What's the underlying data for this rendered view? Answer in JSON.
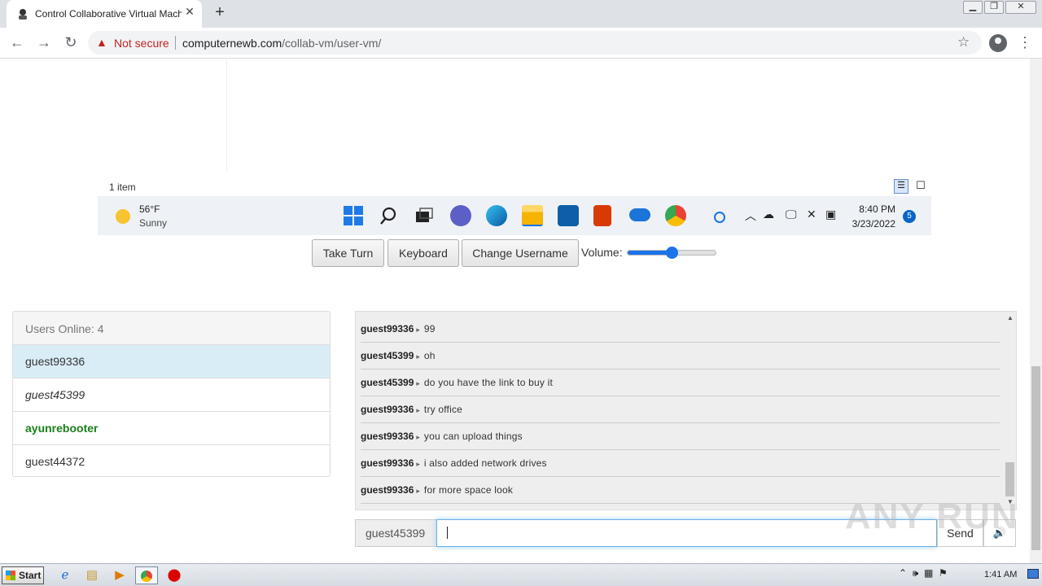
{
  "browser": {
    "tab_title": "Control Collaborative Virtual Machine",
    "tab_close": "✕",
    "new_tab": "+",
    "security_text": "Not secure",
    "url_domain": "computernewb.com",
    "url_path": "/collab-vm/user-vm/"
  },
  "vm": {
    "explorer_status": "1 item",
    "weather_temp": "56°F",
    "weather_desc": "Sunny",
    "clock_time": "8:40 PM",
    "clock_date": "3/23/2022",
    "notification_count": "5"
  },
  "controls": {
    "take_turn": "Take Turn",
    "keyboard": "Keyboard",
    "change_username": "Change Username",
    "volume_label": "Volume:",
    "volume_level": 0.5
  },
  "users": {
    "header": "Users Online: 4",
    "list": [
      {
        "name": "guest99336",
        "style": "self"
      },
      {
        "name": "guest45399",
        "style": "italic"
      },
      {
        "name": "ayunrebooter",
        "style": "admin"
      },
      {
        "name": "guest44372",
        "style": "normal"
      }
    ]
  },
  "chat": {
    "messages": [
      {
        "user": "guest99336",
        "text": "99"
      },
      {
        "user": "guest45399",
        "text": "oh"
      },
      {
        "user": "guest45399",
        "text": "do you have the link to buy it"
      },
      {
        "user": "guest99336",
        "text": "try office"
      },
      {
        "user": "guest99336",
        "text": "you can upload things"
      },
      {
        "user": "guest99336",
        "text": "i also added network drives"
      },
      {
        "user": "guest99336",
        "text": "for more space look"
      }
    ],
    "my_username": "guest45399",
    "input_value": "",
    "send_label": "Send"
  },
  "watermark": "ANY RUN",
  "host_taskbar": {
    "start_label": "Start",
    "clock": "1:41 AM"
  },
  "colors": {
    "accent": "#1a73e8",
    "self_highlight": "#d9edf7",
    "admin_green": "#1a7f1a",
    "not_secure_red": "#c5221f"
  }
}
